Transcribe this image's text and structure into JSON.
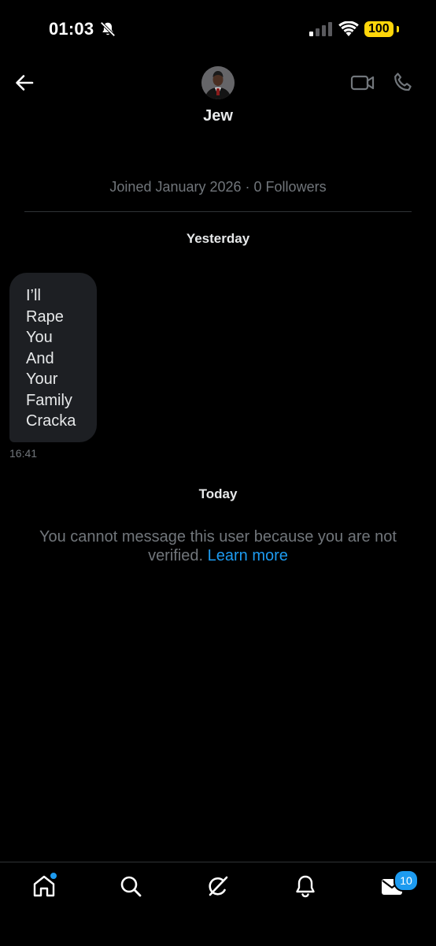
{
  "status_bar": {
    "time": "01:03",
    "battery": "100",
    "battery_color": "#ffd60a"
  },
  "header": {
    "back_icon": "arrow-left-icon",
    "contact_name": "Jew",
    "video_icon": "video-camera-icon",
    "call_icon": "phone-icon"
  },
  "profile_meta": "Joined January 2026 · 0 Followers",
  "conversation": {
    "date_yesterday": "Yesterday",
    "message": {
      "lines": [
        "I’ll",
        "Rape",
        "You",
        "And",
        "Your",
        "Family",
        "Cracka"
      ],
      "time": "16:41"
    },
    "date_today": "Today"
  },
  "notice": {
    "text": "You cannot message this user because you are not verified.",
    "link": "Learn more",
    "link_color": "#1d9bf0"
  },
  "bottom_nav": {
    "items": [
      "home-icon",
      "search-icon",
      "grok-icon",
      "notifications-bell-icon",
      "messages-envelope-icon"
    ],
    "messages_badge": "10"
  }
}
